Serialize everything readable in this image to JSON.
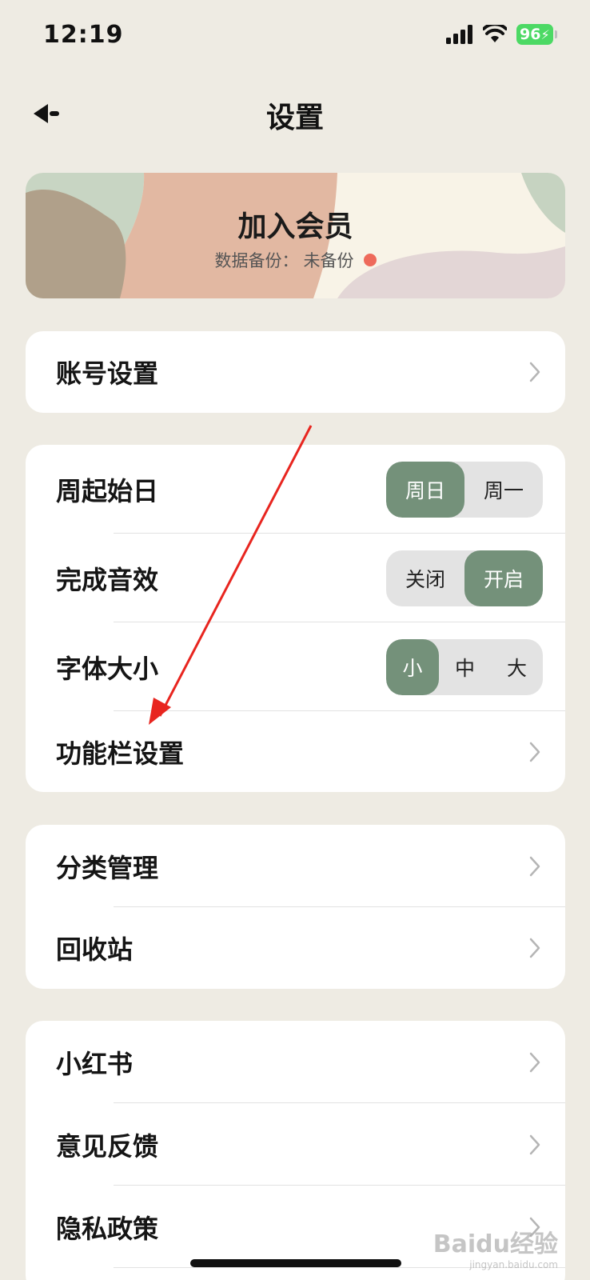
{
  "status_bar": {
    "time": "12:19",
    "battery": "96"
  },
  "header": {
    "title": "设置"
  },
  "member": {
    "title": "加入会员",
    "backup_label": "数据备份：",
    "backup_status": "未备份"
  },
  "account": {
    "label": "账号设置"
  },
  "preferences": {
    "week_start": {
      "label": "周起始日",
      "options": [
        "周日",
        "周一"
      ],
      "selected": "周日"
    },
    "sound": {
      "label": "完成音效",
      "options": [
        "关闭",
        "开启"
      ],
      "selected": "开启"
    },
    "font_size": {
      "label": "字体大小",
      "options": [
        "小",
        "中",
        "大"
      ],
      "selected": "小"
    },
    "toolbar": {
      "label": "功能栏设置"
    }
  },
  "manage": {
    "category": "分类管理",
    "trash": "回收站"
  },
  "about": {
    "xiaohongshu": "小红书",
    "feedback": "意见反馈",
    "privacy": "隐私政策"
  },
  "watermark": {
    "text": "Baidu经验",
    "sub": "jingyan.baidu.com"
  },
  "colors": {
    "accent": "#74917a",
    "background": "#eeebe3",
    "dot": "#ee6a5b",
    "annotation": "#e8251f"
  }
}
